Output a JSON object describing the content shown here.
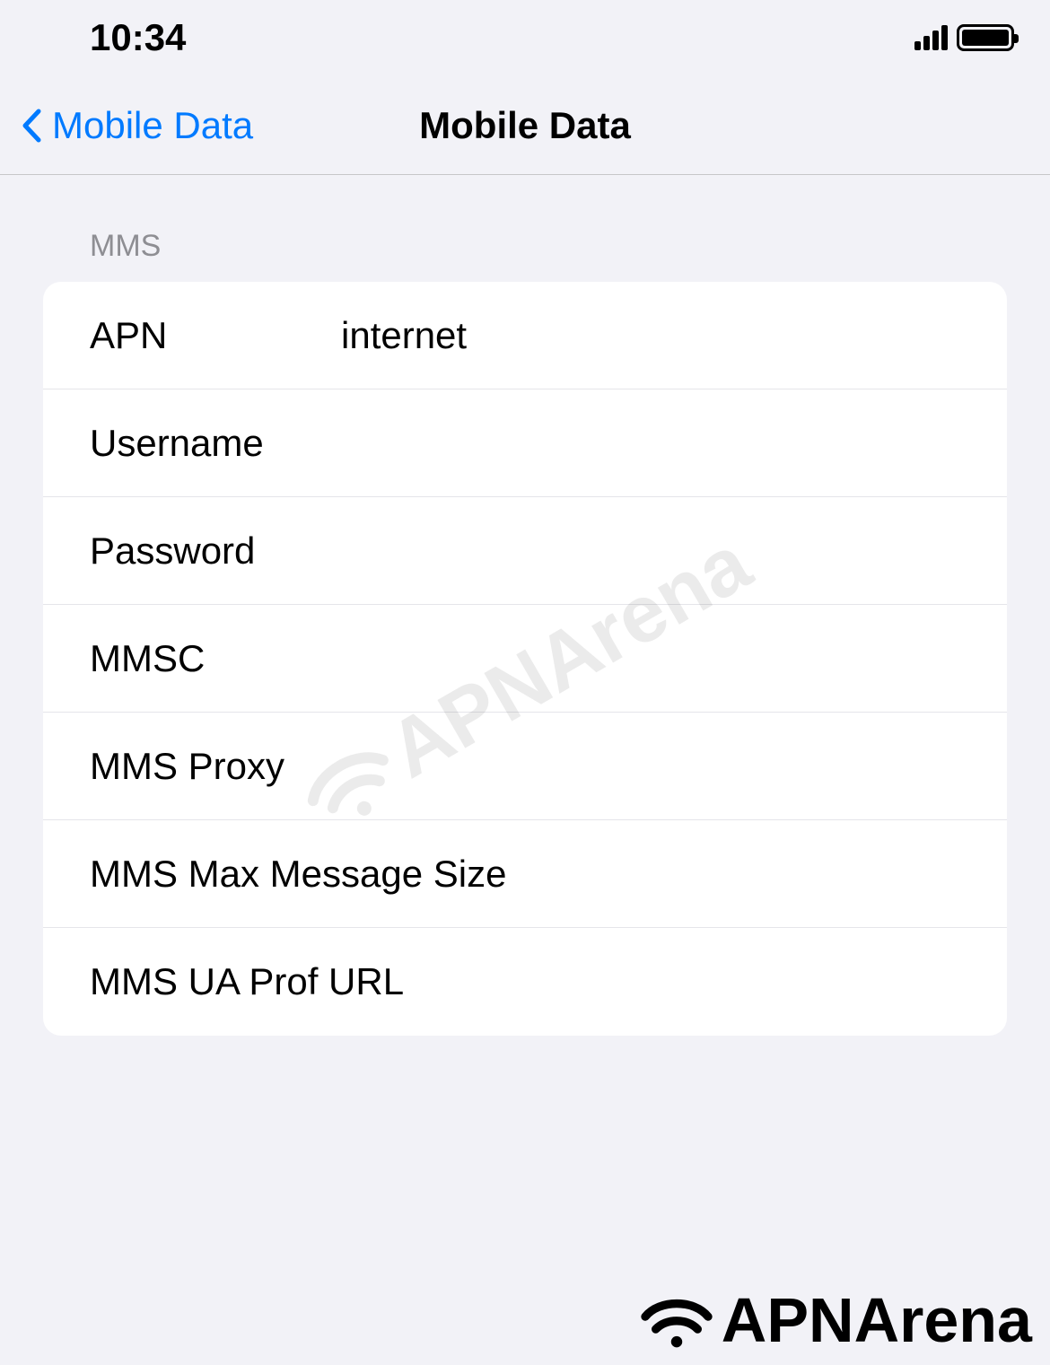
{
  "status": {
    "time": "10:34"
  },
  "nav": {
    "back_label": "Mobile Data",
    "title": "Mobile Data"
  },
  "section": {
    "header": "MMS"
  },
  "fields": {
    "apn": {
      "label": "APN",
      "value": "internet"
    },
    "username": {
      "label": "Username",
      "value": ""
    },
    "password": {
      "label": "Password",
      "value": ""
    },
    "mmsc": {
      "label": "MMSC",
      "value": ""
    },
    "mms_proxy": {
      "label": "MMS Proxy",
      "value": ""
    },
    "mms_max": {
      "label": "MMS Max Message Size",
      "value": ""
    },
    "mms_ua": {
      "label": "MMS UA Prof URL",
      "value": ""
    }
  },
  "watermark": "APNArena"
}
